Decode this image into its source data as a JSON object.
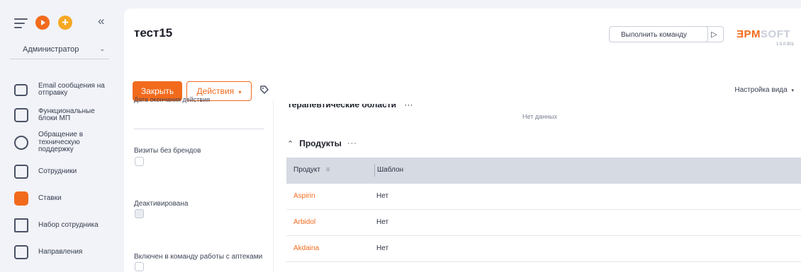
{
  "app": {
    "logo_main": "ƎPM",
    "logo_soft": "SOFT",
    "version": "1.5.0.901"
  },
  "sidebar": {
    "role": "Администратор",
    "items": [
      {
        "label": "Email сообщения на отправку",
        "icon": "mail-icon",
        "active": false
      },
      {
        "label": "Функциональные блоки МП",
        "icon": "layout-icon",
        "active": false
      },
      {
        "label": "Обращение в техническую поддержку",
        "icon": "chat-support-icon",
        "active": false
      },
      {
        "label": "Сотрудники",
        "icon": "employee-icon",
        "active": false
      },
      {
        "label": "Ставки",
        "icon": "rates-icon",
        "active": true
      },
      {
        "label": "Набор сотрудника",
        "icon": "workflow-icon",
        "active": false
      },
      {
        "label": "Направления",
        "icon": "document-icon",
        "active": false
      }
    ]
  },
  "header": {
    "title": "тест15",
    "command_placeholder": "Выполнить команду",
    "close_label": "Закрыть",
    "actions_label": "Действия",
    "view_settings_label": "Настройка вида"
  },
  "left_fields": {
    "end_date_label": "Дата окончания действия",
    "visits_label": "Визиты без брендов",
    "deactivated_label": "Деактивирована",
    "pharmacy_label": "Включен в команду работы с аптеками"
  },
  "therapeutic": {
    "title": "Терапевтические области",
    "empty_text": "Нет данных"
  },
  "products": {
    "title": "Продукты",
    "columns": [
      "Продукт",
      "Шаблон"
    ],
    "rows": [
      {
        "product": "Aspirin",
        "template": "Нет"
      },
      {
        "product": "Arbidol",
        "template": "Нет"
      },
      {
        "product": "Akdaina",
        "template": "Нет"
      }
    ]
  },
  "colors": {
    "accent": "#f26b1d",
    "secondary_accent": "#f7a823"
  }
}
